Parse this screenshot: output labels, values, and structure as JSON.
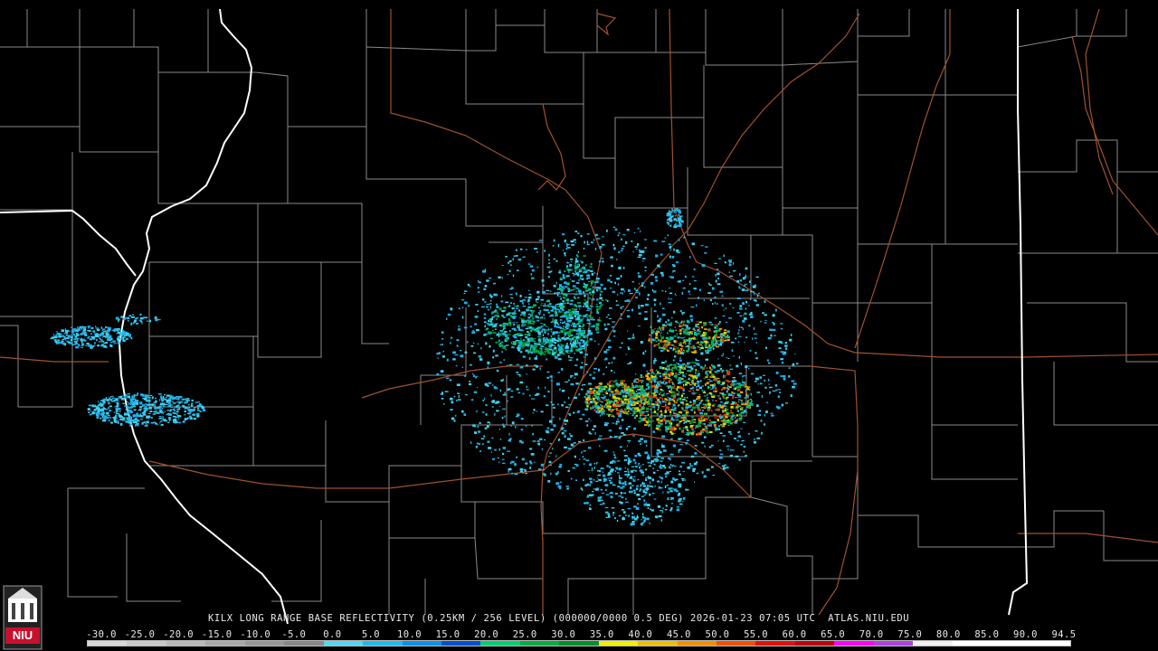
{
  "caption": {
    "text": "KILX LONG RANGE BASE REFLECTIVITY (0.25KM / 256 LEVEL) (000000/0000 0.5 DEG) 2026-01-23 07:05 UTC  ATLAS.NIU.EDU"
  },
  "scale": {
    "labels": [
      "-30.0",
      "-25.0",
      "-20.0",
      "-15.0",
      "-10.0",
      "-5.0",
      "0.0",
      "5.0",
      "10.0",
      "15.0",
      "20.0",
      "25.0",
      "30.0",
      "35.0",
      "40.0",
      "45.0",
      "50.0",
      "55.0",
      "60.0",
      "65.0",
      "70.0",
      "75.0",
      "80.0",
      "85.0",
      "90.0",
      "94.5"
    ],
    "colors": [
      "#d8d8d8",
      "#c8c8c8",
      "#b8b8b8",
      "#a8a8a8",
      "#989898",
      "#888888",
      "#50d8f0",
      "#20b8f0",
      "#0a90e8",
      "#0050d0",
      "#00d070",
      "#00b040",
      "#009028",
      "#f0f000",
      "#e8c000",
      "#f09000",
      "#f05000",
      "#e01010",
      "#c00010",
      "#ff00ff",
      "#b040e0",
      "#f0f0f0",
      "#ffffff",
      "#ffffff",
      "#ffffff"
    ]
  },
  "map": {
    "state_border_color": "#ffffff",
    "county_line_color": "#8a8a8a",
    "highway_color": "#a0522d",
    "echo_colors": [
      "#40d0f0",
      "#20b0e8",
      "#00c080",
      "#00a040",
      "#d0e000",
      "#f0a000",
      "#e04000"
    ]
  },
  "logo": {
    "text": "NIU",
    "color": "#c8102e"
  }
}
